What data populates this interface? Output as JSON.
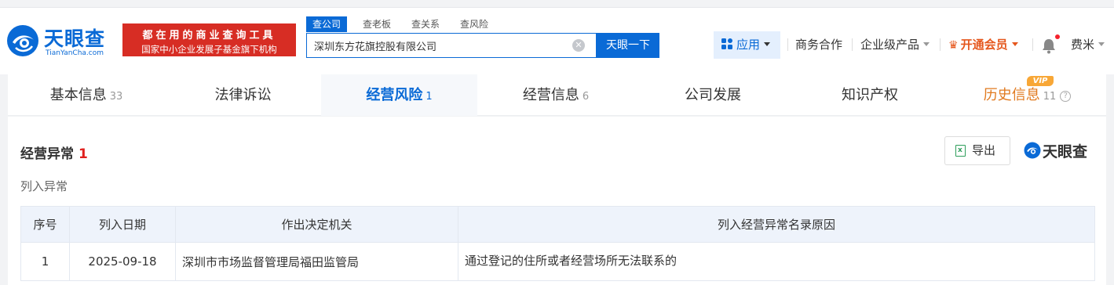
{
  "header": {
    "logo_text": "天眼查",
    "logo_sub": "TianYanCha.com",
    "slogan_line1": "都在用的商业查询工具",
    "slogan_line2": "国家中小企业发展子基金旗下机构",
    "search_tabs": [
      "查公司",
      "查老板",
      "查关系",
      "查风险"
    ],
    "search_value": "深圳东方花旗控股有限公司",
    "search_button": "天眼一下",
    "nav": {
      "apps": "应用",
      "business": "商务合作",
      "enterprise": "企业级产品",
      "vip": "开通会员",
      "user": "费米"
    }
  },
  "tabs": [
    {
      "label": "基本信息",
      "count": "33"
    },
    {
      "label": "法律诉讼",
      "count": ""
    },
    {
      "label": "经营风险",
      "count": "1"
    },
    {
      "label": "经营信息",
      "count": "6"
    },
    {
      "label": "公司发展",
      "count": ""
    },
    {
      "label": "知识产权",
      "count": ""
    },
    {
      "label": "历史信息",
      "count": "11"
    }
  ],
  "vip_badge": "VIP",
  "section": {
    "title": "经营异常",
    "count": "1",
    "subtitle": "列入异常",
    "export_label": "导出",
    "brand": "天眼查"
  },
  "table": {
    "headers": [
      "序号",
      "列入日期",
      "作出决定机关",
      "列入经营异常名录原因"
    ],
    "rows": [
      {
        "index": "1",
        "date": "2025-09-18",
        "authority": "深圳市市场监督管理局福田监管局",
        "reason": "通过登记的住所或者经营场所无法联系的"
      }
    ]
  },
  "colors": {
    "brand_blue": "#0a6ad6",
    "slogan_red": "#d72d24",
    "vip_orange": "#e5571d",
    "count_red": "#e0201e"
  }
}
